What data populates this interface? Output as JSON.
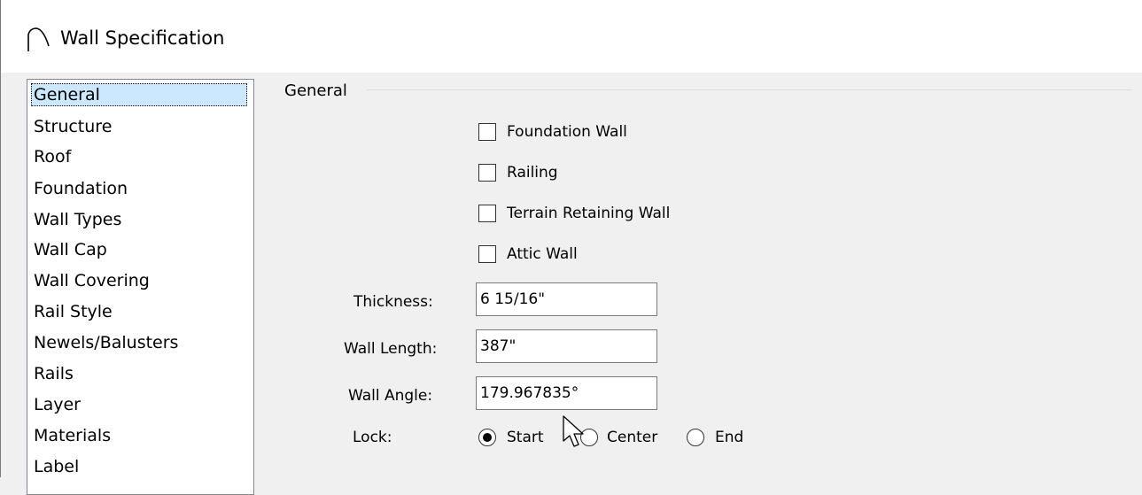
{
  "window": {
    "title": "Wall Specification",
    "icon": "wall-arc-icon"
  },
  "sidebar": {
    "items": [
      {
        "label": "General",
        "selected": true
      },
      {
        "label": "Structure"
      },
      {
        "label": "Roof"
      },
      {
        "label": "Foundation"
      },
      {
        "label": "Wall Types"
      },
      {
        "label": "Wall Cap"
      },
      {
        "label": "Wall Covering"
      },
      {
        "label": "Rail Style"
      },
      {
        "label": "Newels/Balusters"
      },
      {
        "label": "Rails"
      },
      {
        "label": "Layer"
      },
      {
        "label": "Materials"
      },
      {
        "label": "Label"
      }
    ]
  },
  "general": {
    "group_label": "General",
    "checkboxes": [
      {
        "label": "Foundation Wall",
        "checked": false
      },
      {
        "label": "Railing",
        "checked": false
      },
      {
        "label": "Terrain Retaining Wall",
        "checked": false
      },
      {
        "label": "Attic Wall",
        "checked": false
      }
    ],
    "thickness": {
      "label": "Thickness:",
      "value": "6 15/16\""
    },
    "wall_length": {
      "label": "Wall Length:",
      "value": "387\""
    },
    "wall_angle": {
      "label": "Wall Angle:",
      "value": "179.967835°"
    },
    "lock": {
      "label": "Lock:",
      "options": [
        {
          "label": "Start",
          "selected": true
        },
        {
          "label": "Center",
          "selected": false
        },
        {
          "label": "End",
          "selected": false
        }
      ]
    }
  },
  "colors": {
    "selection_background": "#cce8ff",
    "dialog_background": "#f0f0f0"
  }
}
